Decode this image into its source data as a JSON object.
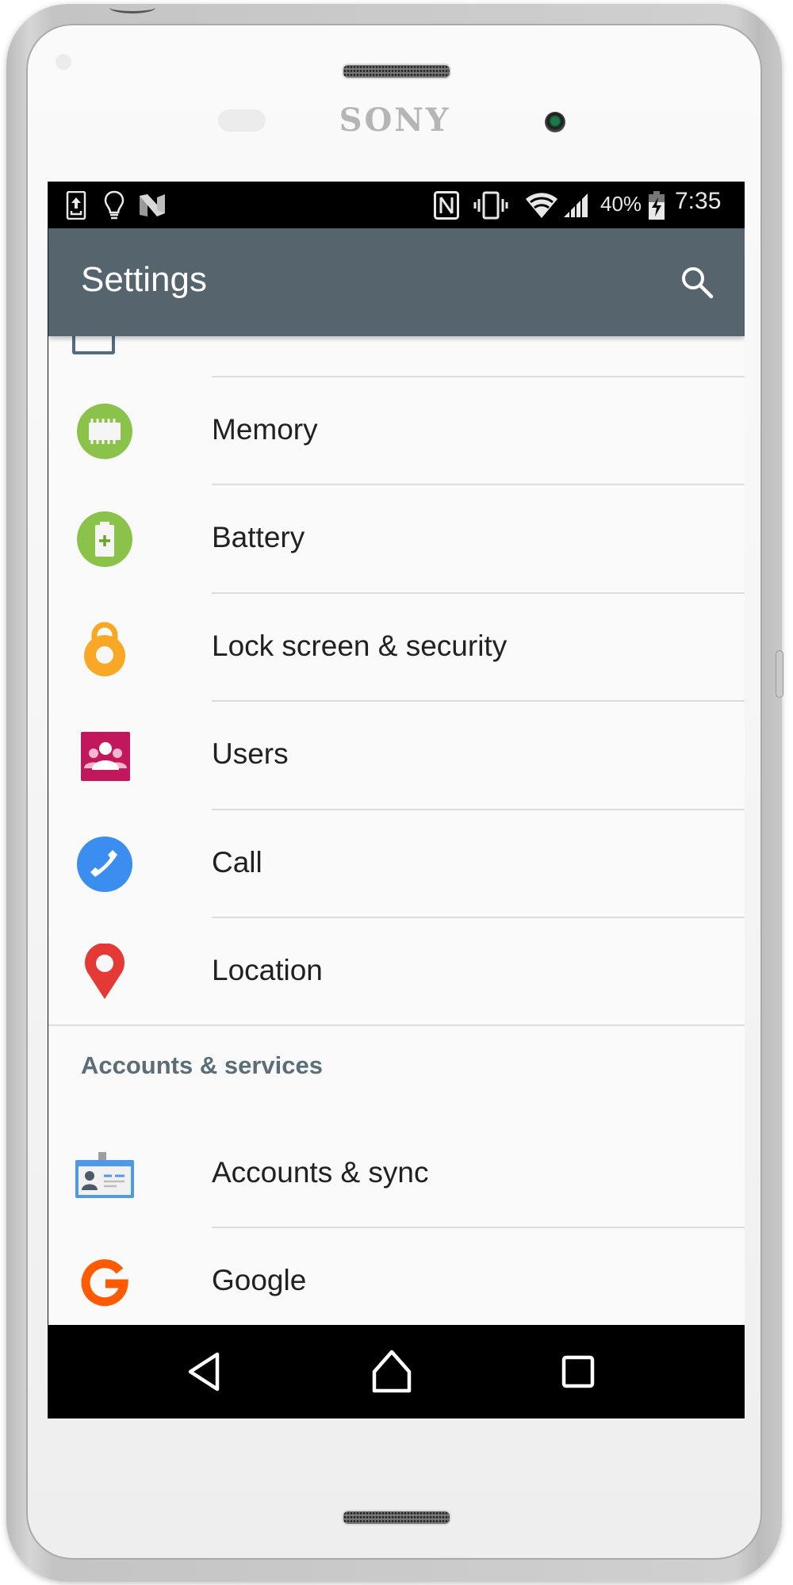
{
  "device": {
    "brand": "SONY"
  },
  "status_bar": {
    "left_icons": [
      "screen-upload-icon",
      "lightbulb-icon",
      "android-n-icon"
    ],
    "right_icons": [
      "nfc-icon",
      "vibrate-icon",
      "wifi-icon",
      "signal-icon",
      "battery-charging-icon"
    ],
    "battery_percent": "40%",
    "time": "7:35"
  },
  "app_bar": {
    "title": "Settings",
    "search_icon": "search-icon",
    "color": "#56656d"
  },
  "settings_list": {
    "items": [
      {
        "label": "Memory",
        "icon": "memory-icon",
        "color": "#8bc34a"
      },
      {
        "label": "Battery",
        "icon": "battery-icon",
        "color": "#8bc34a"
      },
      {
        "label": "Lock screen & security",
        "icon": "lock-icon",
        "color": "#f9a825"
      },
      {
        "label": "Users",
        "icon": "users-icon",
        "color": "#c2185b"
      },
      {
        "label": "Call",
        "icon": "call-icon",
        "color": "#3b8ef0"
      },
      {
        "label": "Location",
        "icon": "location-pin-icon",
        "color": "#e53935"
      }
    ],
    "section_header": "Accounts & services",
    "account_items": [
      {
        "label": "Accounts & sync",
        "icon": "accounts-sync-icon",
        "color": "#4f9ae8"
      },
      {
        "label": "Google",
        "icon": "google-icon",
        "color": "#ff5a00"
      }
    ]
  },
  "nav_bar": {
    "back": "back-icon",
    "home": "home-icon",
    "recents": "recents-icon"
  }
}
